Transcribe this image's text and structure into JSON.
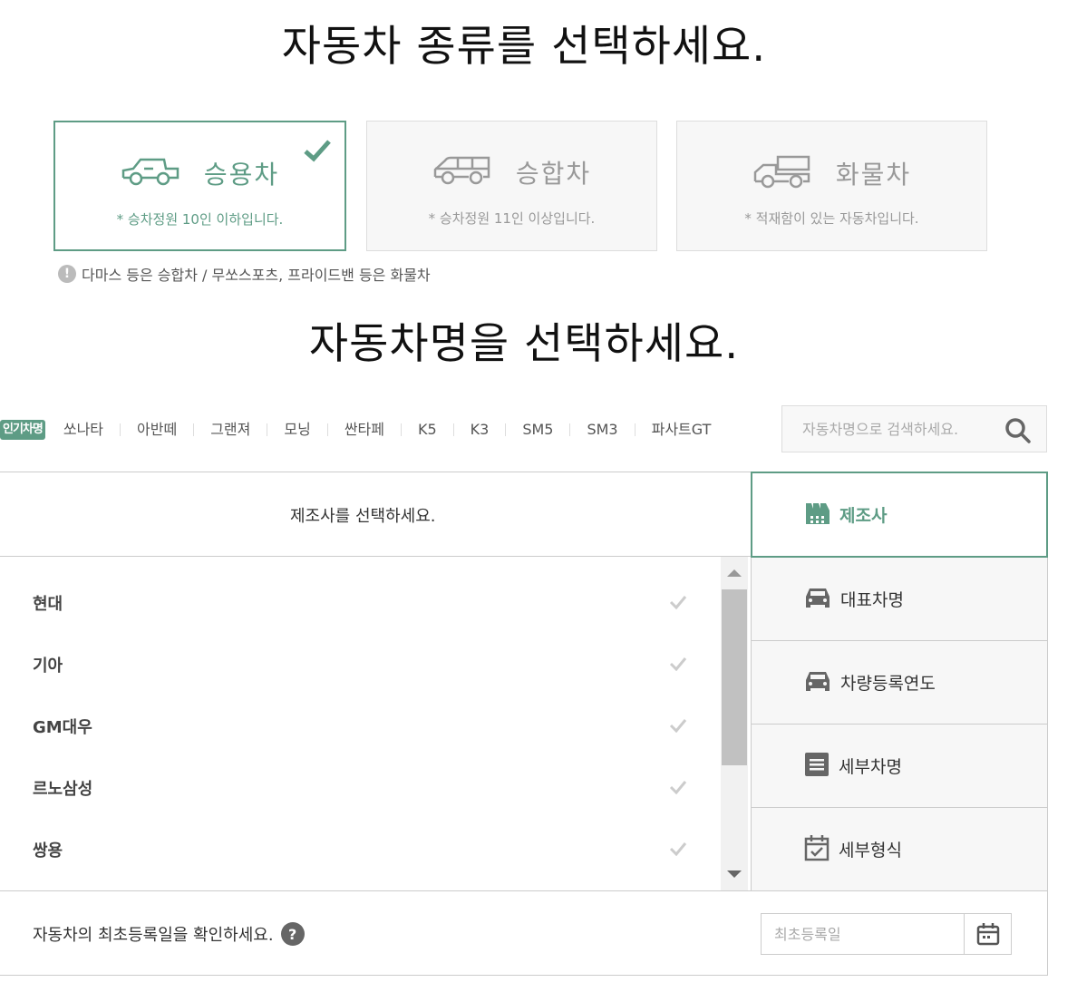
{
  "colors": {
    "accent": "#5e9c85",
    "muted": "#999999"
  },
  "title_type": "자동차 종류를 선택하세요.",
  "title_name": "자동차명을 선택하세요.",
  "car_types": [
    {
      "label": "승용차",
      "desc": "* 승차정원 10인 이하입니다.",
      "selected": true,
      "icon": "sedan-icon"
    },
    {
      "label": "승합차",
      "desc": "* 승차정원 11인 이상입니다.",
      "selected": false,
      "icon": "van-icon"
    },
    {
      "label": "화물차",
      "desc": "* 적재함이 있는 자동차입니다.",
      "selected": false,
      "icon": "truck-icon"
    }
  ],
  "notice": "다마스 등은 승합차 / 무쏘스포츠, 프라이드밴 등은 화물차",
  "popular": {
    "badge": "인기차명",
    "models": [
      "쏘나타",
      "아반떼",
      "그랜져",
      "모닝",
      "싼타페",
      "K5",
      "K3",
      "SM5",
      "SM3",
      "파사트GT"
    ]
  },
  "search": {
    "placeholder": "자동차명으로 검색하세요."
  },
  "maker_prompt": "제조사를 선택하세요.",
  "makers": [
    "현대",
    "기아",
    "GM대우",
    "르노삼성",
    "쌍용"
  ],
  "steps": [
    {
      "label": "제조사",
      "icon": "factory-icon",
      "active": true
    },
    {
      "label": "대표차명",
      "icon": "car-front-icon",
      "active": false
    },
    {
      "label": "차량등록연도",
      "icon": "car-front-icon",
      "active": false
    },
    {
      "label": "세부차명",
      "icon": "list-icon",
      "active": false
    },
    {
      "label": "세부형식",
      "icon": "calendar-check-icon",
      "active": false
    }
  ],
  "registration": {
    "question": "자동차의 최초등록일을 확인하세요.",
    "help": "?",
    "placeholder": "최초등록일"
  }
}
